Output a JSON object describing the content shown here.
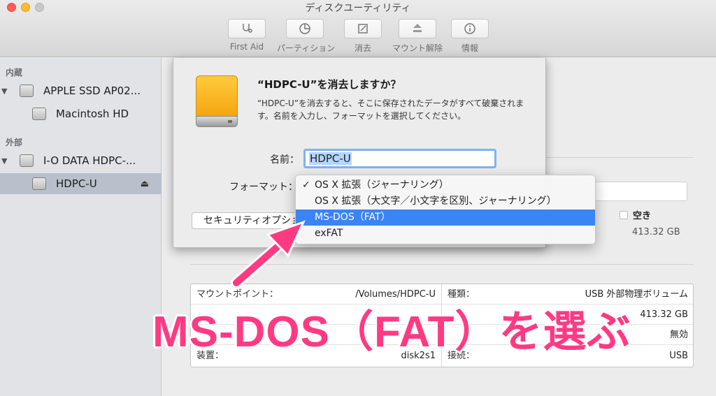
{
  "window": {
    "title": "ディスクユーティリティ"
  },
  "toolbar": {
    "items": [
      {
        "label": "First Aid",
        "icon": "stethoscope-icon"
      },
      {
        "label": "パーティション",
        "icon": "partition-icon"
      },
      {
        "label": "消去",
        "icon": "erase-icon"
      },
      {
        "label": "マウント解除",
        "icon": "unmount-icon"
      },
      {
        "label": "情報",
        "icon": "info-icon"
      }
    ]
  },
  "sidebar": {
    "internal_label": "内蔵",
    "external_label": "外部",
    "items": [
      {
        "label": "APPLE SSD AP02..."
      },
      {
        "label": "Macintosh HD"
      },
      {
        "label": "I-O DATA HDPC-..."
      },
      {
        "label": "HDPC-U"
      }
    ],
    "eject_glyph": "⏏"
  },
  "dialog": {
    "title": "“HDPC-U”を消去しますか？",
    "description": "“HDPC-U”を消去すると、そこに保存されたデータがすべて破棄されます。名前を入力し、フォーマットを選択してください。",
    "name_label": "名前：",
    "name_value": "HDPC-U",
    "format_label": "フォーマット：",
    "security_button": "セキュリティオプション..."
  },
  "format_menu": {
    "items": [
      {
        "label": "OS X 拡張（ジャーナリング）",
        "checked": true
      },
      {
        "label": "OS X 拡張（大文字／小文字を区別、ジャーナリング）",
        "checked": false
      },
      {
        "label": "MS-DOS（FAT）",
        "checked": false,
        "highlighted": true
      },
      {
        "label": "exFAT",
        "checked": false
      }
    ],
    "check_glyph": "✓"
  },
  "capacity": {
    "free_label": "空き",
    "free_size": "413.32 GB"
  },
  "info": {
    "left": [
      {
        "key": "マウントポイント：",
        "value": "/Volumes/HDPC-U"
      },
      {
        "key": "",
        "value": ""
      },
      {
        "key": "",
        "value": ""
      },
      {
        "key": "装置：",
        "value": "disk2s1"
      }
    ],
    "right": [
      {
        "key": "種類：",
        "value": "USB 外部物理ボリューム"
      },
      {
        "key": "",
        "value": "413.32 GB"
      },
      {
        "key": "",
        "value": "無効"
      },
      {
        "key": "接続：",
        "value": "USB"
      }
    ]
  },
  "annotation": {
    "text": "MS-DOS（FAT）を選ぶ",
    "color": "#ff3a83"
  },
  "colors": {
    "selection_blue": "#3a84f5",
    "sidebar_selected": "#b9c0cb",
    "disk_orange": "#f4a30d"
  }
}
